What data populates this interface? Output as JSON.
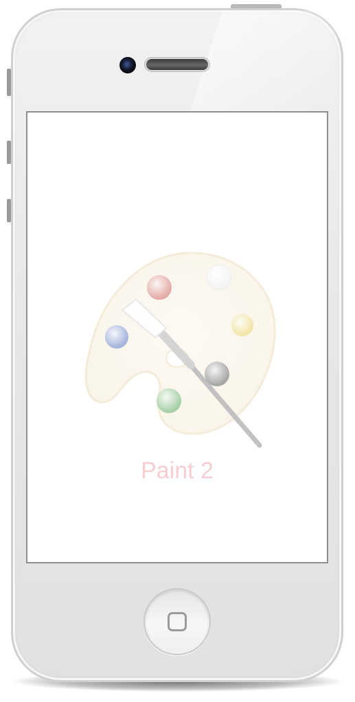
{
  "device": {
    "kind": "iPhone",
    "color": "#ebebeb"
  },
  "app": {
    "name": "Paint 2",
    "label_color": "#f7cfd0",
    "icon": "paint-palette-icon"
  },
  "palette": {
    "paint_colors": [
      "#c0392b",
      "#e8e8e8",
      "#e2c330",
      "#2e2e2e",
      "#2f8f2f",
      "#2b4fb0"
    ]
  }
}
